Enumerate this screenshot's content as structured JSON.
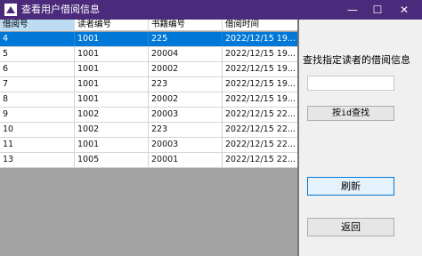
{
  "window": {
    "title": "查看用户借阅信息",
    "controls": {
      "minimize": "—",
      "maximize": "☐",
      "close": "✕"
    }
  },
  "table": {
    "columns": [
      "借阅号",
      "读者编号",
      "书籍编号",
      "借阅时间"
    ],
    "sorted_column": 0,
    "selected_row": 0,
    "rows": [
      [
        "4",
        "1001",
        "225",
        "2022/12/15 19..."
      ],
      [
        "5",
        "1001",
        "20004",
        "2022/12/15 19..."
      ],
      [
        "6",
        "1001",
        "20002",
        "2022/12/15 19..."
      ],
      [
        "7",
        "1001",
        "223",
        "2022/12/15 19..."
      ],
      [
        "8",
        "1001",
        "20002",
        "2022/12/15 19..."
      ],
      [
        "9",
        "1002",
        "20003",
        "2022/12/15 22..."
      ],
      [
        "10",
        "1002",
        "223",
        "2022/12/15 22..."
      ],
      [
        "11",
        "1001",
        "20003",
        "2022/12/15 22..."
      ],
      [
        "13",
        "1005",
        "20001",
        "2022/12/15 22..."
      ]
    ]
  },
  "panel": {
    "search_label": "查找指定读者的借阅信息",
    "search_value": "",
    "search_button": "按id查找",
    "refresh_button": "刷新",
    "back_button": "返回"
  },
  "colors": {
    "titlebar": "#4b2a7b",
    "selection": "#0078d7",
    "empty_area": "#a3a3a3"
  }
}
